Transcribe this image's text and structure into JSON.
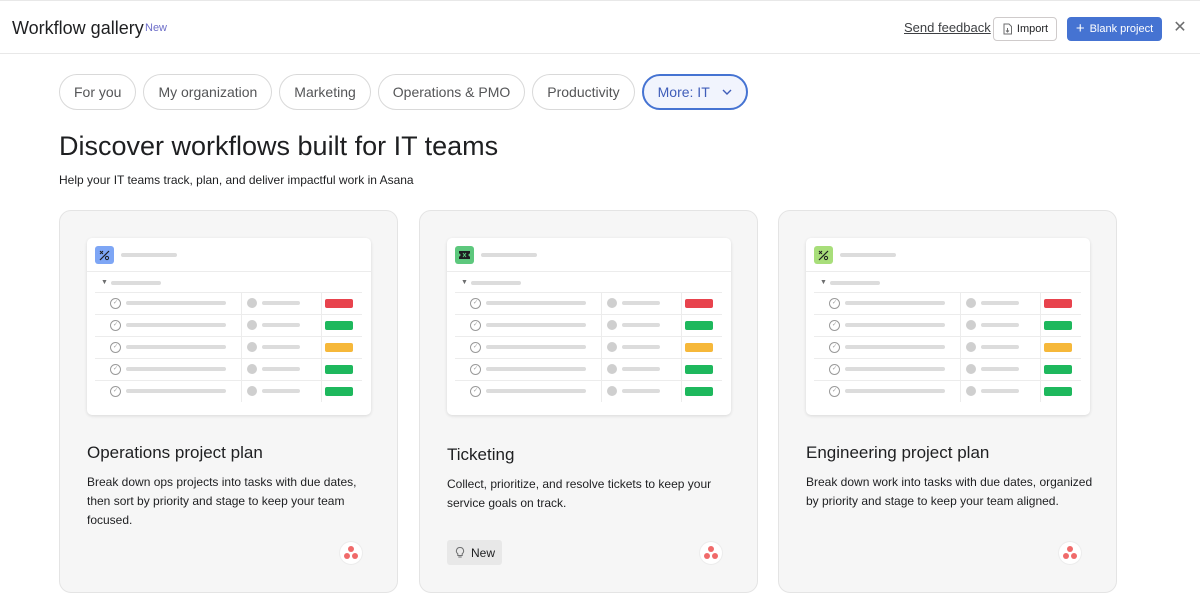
{
  "header": {
    "title": "Workflow gallery",
    "new_tag": "New",
    "feedback_label": "Send feedback",
    "import_label": "Import",
    "blank_project_label": "Blank project",
    "close_glyph": "✕"
  },
  "tabs": [
    {
      "label": "For you"
    },
    {
      "label": "My organization"
    },
    {
      "label": "Marketing"
    },
    {
      "label": "Operations & PMO"
    },
    {
      "label": "Productivity"
    },
    {
      "label": "More: IT",
      "selected": true
    }
  ],
  "main": {
    "heading": "Discover workflows built for IT teams",
    "subheading": "Help your IT teams track, plan, and deliver impactful work in Asana"
  },
  "cards": [
    {
      "title": "Operations project plan",
      "description": "Break down ops projects into tasks with due dates, then sort by priority and stage to keep your team focused.",
      "icon": "percent-icon",
      "icon_color": "#7ea6f5",
      "status_colors": [
        "#e8434d",
        "#1eb85d",
        "#f6b83a",
        "#1eb85d",
        "#1eb85d"
      ]
    },
    {
      "title": "Ticketing",
      "description": "Collect, prioritize, and resolve tickets to keep your service goals on track.",
      "icon": "ticket-icon",
      "icon_color": "#5dc87d",
      "status_colors": [
        "#e8434d",
        "#1eb85d",
        "#f6b83a",
        "#1eb85d",
        "#1eb85d"
      ],
      "badge": "New"
    },
    {
      "title": "Engineering project plan",
      "description": "Break down work into tasks with due dates, organized by priority and stage to keep your team aligned.",
      "icon": "percent-icon",
      "icon_color": "#a8de7a",
      "status_colors": [
        "#e8434d",
        "#1eb85d",
        "#f6b83a",
        "#1eb85d",
        "#1eb85d"
      ]
    }
  ],
  "colors": {
    "accent": "#4573d2",
    "asana_logo": "#f06a6a"
  }
}
